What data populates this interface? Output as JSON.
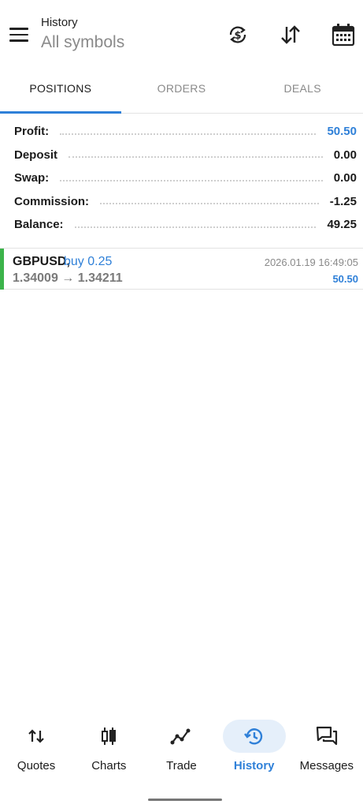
{
  "header": {
    "title": "History",
    "subtitle": "All symbols",
    "icons": [
      "menu-icon",
      "currency-exchange-icon",
      "sort-icon",
      "calendar-icon"
    ]
  },
  "tabs": [
    {
      "label": "POSITIONS",
      "active": true
    },
    {
      "label": "ORDERS",
      "active": false
    },
    {
      "label": "DEALS",
      "active": false
    }
  ],
  "summary": [
    {
      "label": "Profit:",
      "value": "50.50",
      "highlight": true
    },
    {
      "label": "Deposit",
      "value": "0.00",
      "highlight": false
    },
    {
      "label": "Swap:",
      "value": "0.00",
      "highlight": false
    },
    {
      "label": "Commission:",
      "value": "-1.25",
      "highlight": false
    },
    {
      "label": "Balance:",
      "value": "49.25",
      "highlight": false
    }
  ],
  "position": {
    "symbol": "GBPUSD,",
    "trade": "buy 0.25",
    "prices": "1.34009 → 1.34211",
    "time": "2026.01.19 16:49:05",
    "profit": "50.50"
  },
  "bottom_nav": [
    {
      "label": "Quotes",
      "icon": "quotes-icon",
      "active": false
    },
    {
      "label": "Charts",
      "icon": "charts-icon",
      "active": false
    },
    {
      "label": "Trade",
      "icon": "trade-icon",
      "active": false
    },
    {
      "label": "History",
      "icon": "history-icon",
      "active": true
    },
    {
      "label": "Messages",
      "icon": "messages-icon",
      "active": false
    }
  ],
  "colors": {
    "accent": "#2f80d8",
    "buy_bar": "#3cb44b",
    "active_nav_bg": "#e5effa"
  }
}
